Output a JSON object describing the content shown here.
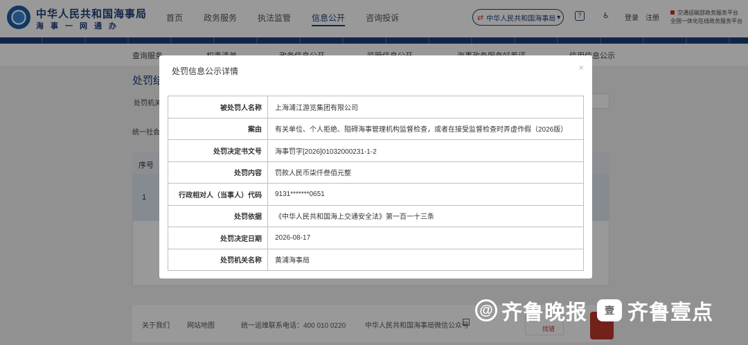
{
  "header": {
    "brand_name": "中华人民共和国海事局",
    "brand_sub": "海事一网通办",
    "nav": [
      "首页",
      "政务服务",
      "执法监管",
      "信息公开",
      "咨询投诉"
    ],
    "nav_active_index": 3,
    "org_select": "中华人民共和国海事局",
    "login": "登录",
    "register": "注册",
    "platform_links": [
      "交通运输部政务服务平台",
      "全国一体化在线政务服务平台"
    ]
  },
  "subnav": {
    "items": [
      "查询服务",
      "权责清单",
      "政务信息公开",
      "监管信息公开",
      "海事政务服务好差评",
      "信用信息公示"
    ]
  },
  "page": {
    "title": "处罚结",
    "filter_label_1": "处罚机关",
    "filter_label_2": "统一社会",
    "table_header_no": "序号",
    "row_no": "1"
  },
  "modal": {
    "title": "处罚信息公示详情",
    "close": "×",
    "rows": [
      {
        "label": "被处罚人名称",
        "value": "上海浦江游览集团有限公司"
      },
      {
        "label": "案由",
        "value": "有关单位、个人拒绝、阻碍海事管理机构监督检查，或者在接受监督检查时弄虚作假（2026版）"
      },
      {
        "label": "处罚决定书文号",
        "value": "海事罚字[2026]01032000231-1-2"
      },
      {
        "label": "处罚内容",
        "value": "罚款人民币柒仟叁佰元整"
      },
      {
        "label": "行政相对人（当事人）代码",
        "value": "9131*******0651"
      },
      {
        "label": "处罚依据",
        "value": "《中华人民共和国海上交通安全法》第一百一十三条"
      },
      {
        "label": "处罚决定日期",
        "value": "2026-08-17"
      },
      {
        "label": "处罚机关名称",
        "value": "黄浦海事局"
      }
    ]
  },
  "footer": {
    "about": "关于我们",
    "sitemap": "网站地图",
    "hotline": "统一运维联系电话：400 010 0220",
    "wechat": "中华人民共和国海事局微信公众号",
    "badge": "找错"
  },
  "watermark": {
    "circle": "@",
    "name": "齐鲁晚报",
    "logo": "壹",
    "brand": "齐鲁壹点"
  },
  "colors": {
    "primary": "#1d3f7a",
    "accent_red": "#c0392b",
    "overlay": "rgba(0,0,0,0.4)"
  }
}
